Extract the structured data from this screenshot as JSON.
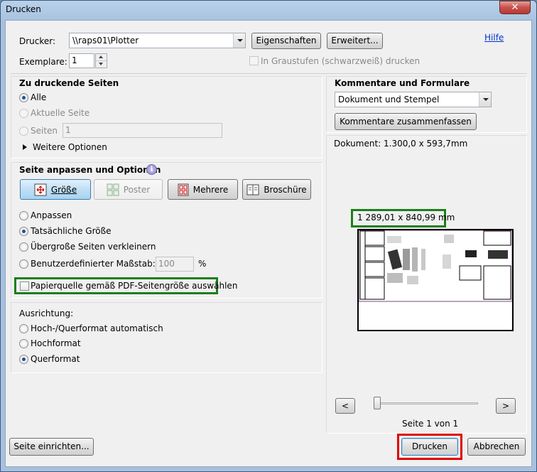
{
  "window": {
    "title": "Drucken",
    "close_label": "✕"
  },
  "header": {
    "printer_label": "Drucker:",
    "printer_value": "\\\\raps01\\Plotter",
    "properties_button": "Eigenschaften",
    "advanced_button": "Erweitert...",
    "help_link": "Hilfe",
    "copies_label": "Exemplare:",
    "copies_value": "1",
    "grayscale_label": "In Graustufen (schwarzweiß) drucken"
  },
  "pages": {
    "heading": "Zu druckende Seiten",
    "all": "Alle",
    "current": "Aktuelle Seite",
    "pages": "Seiten",
    "pages_value": "1",
    "more_options": "Weitere Optionen"
  },
  "fit": {
    "heading": "Seite anpassen und Optionen",
    "size_button": "Größe",
    "poster_button": "Poster",
    "multiple_button": "Mehrere",
    "booklet_button": "Broschüre",
    "fit": "Anpassen",
    "actual_size": "Tatsächliche Größe",
    "shrink_oversized": "Übergroße Seiten verkleinern",
    "custom_scale": "Benutzerdefinierter Maßstab:",
    "custom_scale_value": "100",
    "percent": "%",
    "paper_source": "Papierquelle gemäß PDF-Seitengröße auswählen"
  },
  "orientation": {
    "heading": "Ausrichtung:",
    "auto": "Hoch-/Querformat automatisch",
    "portrait": "Hochformat",
    "landscape": "Querformat"
  },
  "comments": {
    "heading": "Kommentare und Formulare",
    "select_value": "Dokument und Stempel",
    "summarize_button": "Kommentare zusammenfassen"
  },
  "preview": {
    "document_size": "Dokument: 1.300,0 x 593,7mm",
    "paper_size": "1 289,01 x 840,99 mm",
    "prev": "<",
    "next": ">",
    "page_indicator": "Seite 1 von 1"
  },
  "footer": {
    "page_setup_button": "Seite einrichten...",
    "print_button": "Drucken",
    "cancel_button": "Abbrechen"
  }
}
